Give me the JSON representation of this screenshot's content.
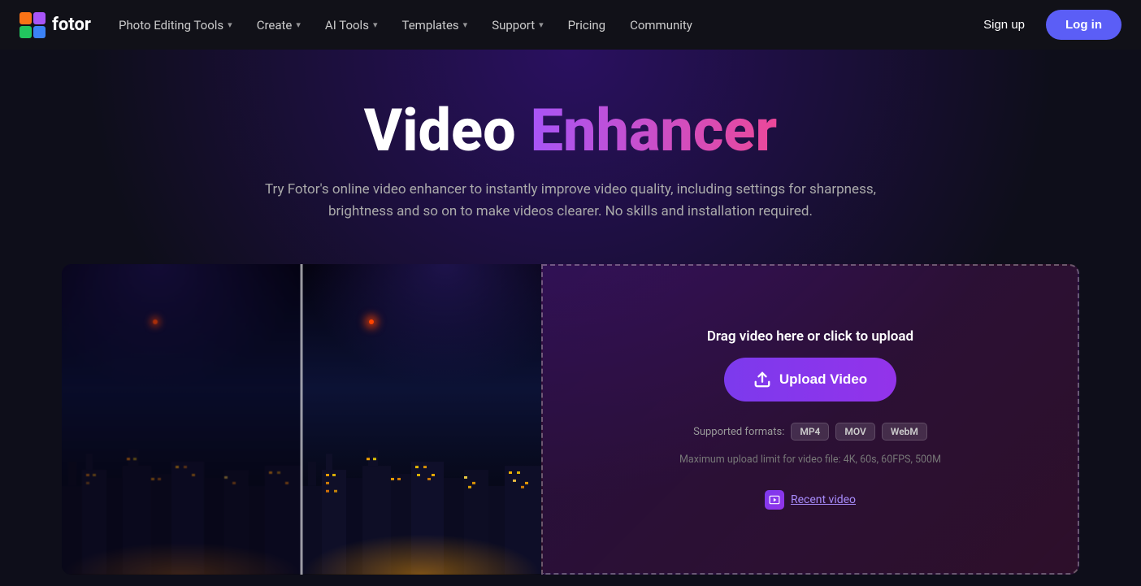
{
  "nav": {
    "logo_text": "fotor",
    "items": [
      {
        "id": "photo-editing-tools",
        "label": "Photo Editing Tools",
        "has_dropdown": true
      },
      {
        "id": "create",
        "label": "Create",
        "has_dropdown": true
      },
      {
        "id": "ai-tools",
        "label": "AI Tools",
        "has_dropdown": true
      },
      {
        "id": "templates",
        "label": "Templates",
        "has_dropdown": true
      },
      {
        "id": "support",
        "label": "Support",
        "has_dropdown": true
      },
      {
        "id": "pricing",
        "label": "Pricing",
        "has_dropdown": false
      },
      {
        "id": "community",
        "label": "Community",
        "has_dropdown": false
      }
    ],
    "signup_label": "Sign up",
    "login_label": "Log in"
  },
  "hero": {
    "title_part1": "Video ",
    "title_part2": "Enhancer",
    "subtitle": "Try Fotor's online video enhancer to instantly improve video quality, including settings for sharpness, brightness and so on to make videos clearer. No skills and installation required."
  },
  "upload": {
    "drag_text": "Drag video here or click to upload",
    "button_label": "Upload Video",
    "formats_label": "Supported formats:",
    "formats": [
      "MP4",
      "MOV",
      "WebM"
    ],
    "limit_text": "Maximum upload limit for video file: 4K, 60s, 60FPS, 500M",
    "recent_label": "Recent video"
  }
}
